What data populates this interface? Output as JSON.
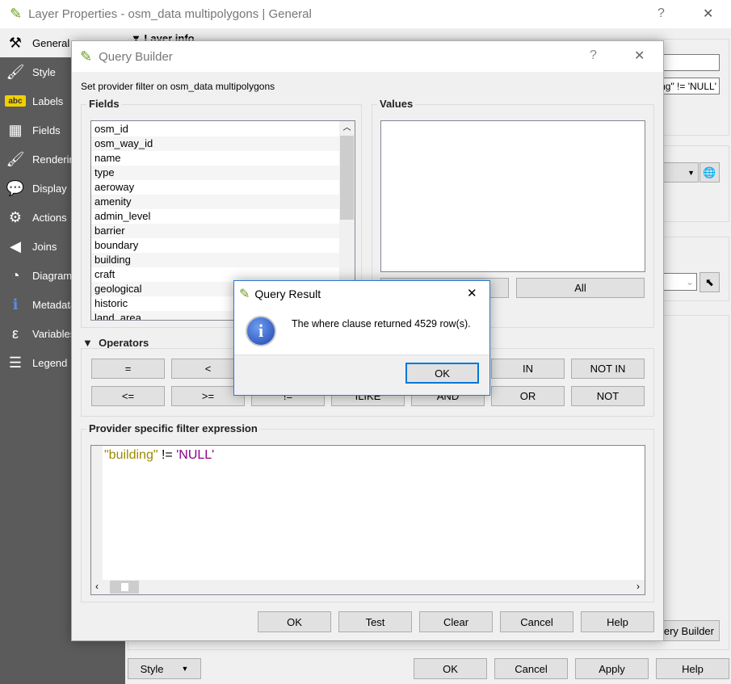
{
  "main_window": {
    "title": "Layer Properties - osm_data multipolygons | General",
    "help": "?",
    "close": "✕",
    "sidebar": [
      {
        "label": "General",
        "icon": "tools-icon"
      },
      {
        "label": "Style",
        "icon": "paintbrush-icon"
      },
      {
        "label": "Labels",
        "icon": "abc-label-icon"
      },
      {
        "label": "Fields",
        "icon": "table-icon"
      },
      {
        "label": "Rendering",
        "icon": "brush-icon"
      },
      {
        "label": "Display",
        "icon": "speech-bubble-icon"
      },
      {
        "label": "Actions",
        "icon": "gear-icon"
      },
      {
        "label": "Joins",
        "icon": "join-icon"
      },
      {
        "label": "Diagrams",
        "icon": "diagram-icon"
      },
      {
        "label": "Metadata",
        "icon": "info-icon"
      },
      {
        "label": "Variables",
        "icon": "epsilon-icon"
      },
      {
        "label": "Legend",
        "icon": "legend-icon"
      }
    ],
    "layer_info_header": "Layer info",
    "subset_value": "\"building\" != 'NULL'",
    "query_builder_button": "Query Builder",
    "style_button": "Style",
    "buttons": [
      "OK",
      "Cancel",
      "Apply",
      "Help"
    ]
  },
  "query_builder": {
    "title": "Query Builder",
    "help": "?",
    "close": "✕",
    "subtitle": "Set provider filter on osm_data multipolygons",
    "fields_label": "Fields",
    "fields": [
      "osm_id",
      "osm_way_id",
      "name",
      "type",
      "aeroway",
      "amenity",
      "admin_level",
      "barrier",
      "boundary",
      "building",
      "craft",
      "geological",
      "historic",
      "land_area"
    ],
    "values_label": "Values",
    "all_button": "All",
    "operators_label": "Operators",
    "operators_row1": [
      "=",
      "<",
      "",
      "",
      "",
      "IN",
      "NOT IN"
    ],
    "operators_row2": [
      "<=",
      ">=",
      "!=",
      "ILIKE",
      "AND",
      "OR",
      "NOT"
    ],
    "expression_label": "Provider specific filter expression",
    "expression": {
      "field": "\"building\"",
      "op": " != ",
      "value": "'NULL'"
    },
    "colors": {
      "field": "#9a8a00",
      "value": "#8b008b"
    },
    "buttons": [
      "OK",
      "Test",
      "Clear",
      "Cancel",
      "Help"
    ]
  },
  "query_result": {
    "title": "Query Result",
    "close": "✕",
    "message": "The where clause returned 4529 row(s).",
    "ok": "OK",
    "icon": "info-icon"
  }
}
